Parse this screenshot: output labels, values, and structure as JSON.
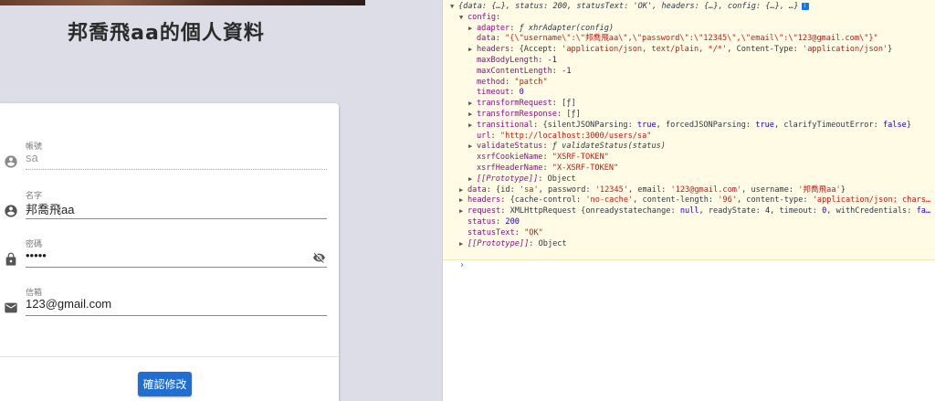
{
  "app": {
    "title": "邦喬飛aa的個人資料",
    "fields": [
      {
        "label": "帳號",
        "value": "sa",
        "icon": "account-circle-icon",
        "disabled": true
      },
      {
        "label": "名字",
        "value": "邦喬飛aa",
        "icon": "account-circle-icon",
        "disabled": false
      },
      {
        "label": "密碼",
        "value": "•••••",
        "icon": "lock-icon",
        "disabled": false
      },
      {
        "label": "信箱",
        "value": "123@gmail.com",
        "icon": "email-icon",
        "disabled": false
      }
    ],
    "submit_label": "確認修改",
    "colors": {
      "primary": "#1e6fd1",
      "background": "#dcdde6"
    }
  },
  "console": {
    "lines": [
      {
        "indent": 0,
        "tri": "▼",
        "parts": [
          {
            "c": "it g",
            "t": "{data: {…}, status: 200, statusText: 'OK', headers: {…}, config: {…}, …}"
          }
        ],
        "badge": "i"
      },
      {
        "indent": 1,
        "tri": "▼",
        "parts": [
          {
            "c": "k",
            "t": "config"
          },
          {
            "c": "g",
            "t": ":"
          }
        ]
      },
      {
        "indent": 2,
        "tri": "▶",
        "parts": [
          {
            "c": "k",
            "t": "adapter"
          },
          {
            "c": "g",
            "t": ": "
          },
          {
            "c": "it g",
            "t": "ƒ xhrAdapter(config)"
          }
        ]
      },
      {
        "indent": 2,
        "tri": "",
        "parts": [
          {
            "c": "k",
            "t": "data"
          },
          {
            "c": "g",
            "t": ": "
          },
          {
            "c": "s",
            "t": "\"{\\\"username\\\":\\\"邦喬飛aa\\\",\\\"password\\\":\\\"12345\\\",\\\"email\\\":\\\"123@gmail.com\\\"}\""
          }
        ]
      },
      {
        "indent": 2,
        "tri": "▶",
        "parts": [
          {
            "c": "k",
            "t": "headers"
          },
          {
            "c": "g",
            "t": ": {Accept: "
          },
          {
            "c": "s",
            "t": "'application/json, text/plain, */*'"
          },
          {
            "c": "g",
            "t": ", Content-Type: "
          },
          {
            "c": "s",
            "t": "'application/json'"
          },
          {
            "c": "g",
            "t": "}"
          }
        ]
      },
      {
        "indent": 2,
        "tri": "",
        "parts": [
          {
            "c": "k",
            "t": "maxBodyLength"
          },
          {
            "c": "g",
            "t": ": "
          },
          {
            "c": "n",
            "t": "-1"
          }
        ]
      },
      {
        "indent": 2,
        "tri": "",
        "parts": [
          {
            "c": "k",
            "t": "maxContentLength"
          },
          {
            "c": "g",
            "t": ": "
          },
          {
            "c": "n",
            "t": "-1"
          }
        ]
      },
      {
        "indent": 2,
        "tri": "",
        "parts": [
          {
            "c": "k",
            "t": "method"
          },
          {
            "c": "g",
            "t": ": "
          },
          {
            "c": "s",
            "t": "\"patch\""
          }
        ]
      },
      {
        "indent": 2,
        "tri": "",
        "parts": [
          {
            "c": "k",
            "t": "timeout"
          },
          {
            "c": "g",
            "t": ": "
          },
          {
            "c": "n",
            "t": "0"
          }
        ]
      },
      {
        "indent": 2,
        "tri": "▶",
        "parts": [
          {
            "c": "k",
            "t": "transformRequest"
          },
          {
            "c": "g",
            "t": ": [ƒ]"
          }
        ]
      },
      {
        "indent": 2,
        "tri": "▶",
        "parts": [
          {
            "c": "k",
            "t": "transformResponse"
          },
          {
            "c": "g",
            "t": ": [ƒ]"
          }
        ]
      },
      {
        "indent": 2,
        "tri": "▶",
        "parts": [
          {
            "c": "k",
            "t": "transitional"
          },
          {
            "c": "g",
            "t": ": {silentJSONParsing: "
          },
          {
            "c": "n",
            "t": "true"
          },
          {
            "c": "g",
            "t": ", forcedJSONParsing: "
          },
          {
            "c": "n",
            "t": "true"
          },
          {
            "c": "g",
            "t": ", clarifyTimeoutError: "
          },
          {
            "c": "n",
            "t": "false"
          },
          {
            "c": "g",
            "t": "}"
          }
        ]
      },
      {
        "indent": 2,
        "tri": "",
        "parts": [
          {
            "c": "k",
            "t": "url"
          },
          {
            "c": "g",
            "t": ": "
          },
          {
            "c": "s",
            "t": "\"http://localhost:3000/users/sa\""
          }
        ]
      },
      {
        "indent": 2,
        "tri": "▶",
        "parts": [
          {
            "c": "k",
            "t": "validateStatus"
          },
          {
            "c": "g",
            "t": ": "
          },
          {
            "c": "it g",
            "t": "ƒ validateStatus(status)"
          }
        ]
      },
      {
        "indent": 2,
        "tri": "",
        "parts": [
          {
            "c": "k",
            "t": "xsrfCookieName"
          },
          {
            "c": "g",
            "t": ": "
          },
          {
            "c": "s",
            "t": "\"XSRF-TOKEN\""
          }
        ]
      },
      {
        "indent": 2,
        "tri": "",
        "parts": [
          {
            "c": "k",
            "t": "xsrfHeaderName"
          },
          {
            "c": "g",
            "t": ": "
          },
          {
            "c": "s",
            "t": "\"X-XSRF-TOKEN\""
          }
        ]
      },
      {
        "indent": 2,
        "tri": "▶",
        "parts": [
          {
            "c": "k it",
            "t": "[[Prototype]]"
          },
          {
            "c": "g",
            "t": ": Object"
          }
        ]
      },
      {
        "indent": 1,
        "tri": "▶",
        "parts": [
          {
            "c": "k",
            "t": "data"
          },
          {
            "c": "g",
            "t": ": {id: "
          },
          {
            "c": "s",
            "t": "'sa'"
          },
          {
            "c": "g",
            "t": ", password: "
          },
          {
            "c": "s",
            "t": "'12345'"
          },
          {
            "c": "g",
            "t": ", email: "
          },
          {
            "c": "s",
            "t": "'123@gmail.com'"
          },
          {
            "c": "g",
            "t": ", username: "
          },
          {
            "c": "s",
            "t": "'邦喬飛aa'"
          },
          {
            "c": "g",
            "t": "}"
          }
        ]
      },
      {
        "indent": 1,
        "tri": "▶",
        "parts": [
          {
            "c": "k",
            "t": "headers"
          },
          {
            "c": "g",
            "t": ": {cache-control: "
          },
          {
            "c": "s",
            "t": "'no-cache'"
          },
          {
            "c": "g",
            "t": ", content-length: "
          },
          {
            "c": "s",
            "t": "'96'"
          },
          {
            "c": "g",
            "t": ", content-type: "
          },
          {
            "c": "s",
            "t": "'application/json; chars…"
          }
        ]
      },
      {
        "indent": 1,
        "tri": "▶",
        "parts": [
          {
            "c": "k",
            "t": "request"
          },
          {
            "c": "g",
            "t": ": XMLHttpRequest {onreadystatechange: "
          },
          {
            "c": "n",
            "t": "null"
          },
          {
            "c": "g",
            "t": ", readyState: "
          },
          {
            "c": "n",
            "t": "4"
          },
          {
            "c": "g",
            "t": ", timeout: "
          },
          {
            "c": "n",
            "t": "0"
          },
          {
            "c": "g",
            "t": ", withCredentials: "
          },
          {
            "c": "n",
            "t": "fa…"
          }
        ]
      },
      {
        "indent": 1,
        "tri": "",
        "parts": [
          {
            "c": "k",
            "t": "status"
          },
          {
            "c": "g",
            "t": ": "
          },
          {
            "c": "n",
            "t": "200"
          }
        ]
      },
      {
        "indent": 1,
        "tri": "",
        "parts": [
          {
            "c": "k",
            "t": "statusText"
          },
          {
            "c": "g",
            "t": ": "
          },
          {
            "c": "s",
            "t": "\"OK\""
          }
        ]
      },
      {
        "indent": 1,
        "tri": "▶",
        "parts": [
          {
            "c": "k it",
            "t": "[[Prototype]]"
          },
          {
            "c": "g",
            "t": ": Object"
          }
        ]
      }
    ],
    "prompt": "›"
  }
}
